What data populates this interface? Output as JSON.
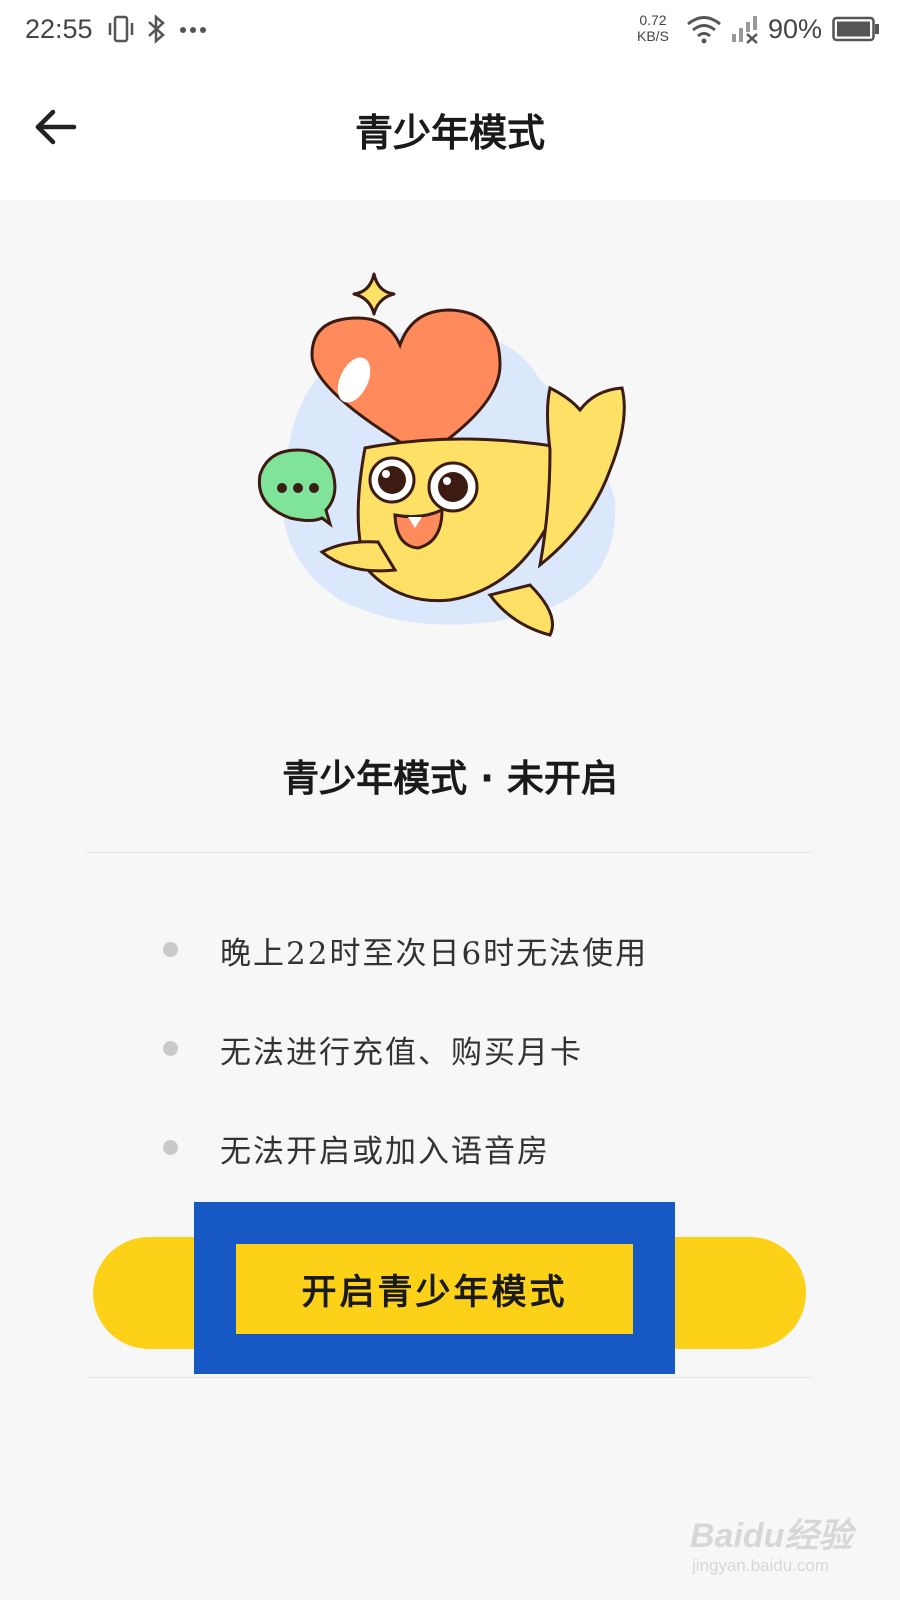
{
  "status_bar": {
    "time": "22:55",
    "net_speed_value": "0.72",
    "net_speed_unit": "KB/S",
    "battery_percent": "90%",
    "icons": [
      "vibrate-icon",
      "bluetooth-icon",
      "more-dots-icon",
      "wifi-icon",
      "signal-icon",
      "battery-icon"
    ]
  },
  "header": {
    "title": "青少年模式",
    "back_icon": "arrow-left-icon"
  },
  "illustration": {
    "name": "yellow-fish-mascot-with-heart",
    "colors": {
      "blob": "#dbe7fb",
      "heart": "#ff8a5b",
      "fish": "#fde066",
      "bubble": "#7fe39a",
      "outline": "#3b1b12"
    }
  },
  "status": {
    "title": "青少年模式 · 未开启"
  },
  "rules": [
    {
      "text": "晚上22时至次日6时无法使用"
    },
    {
      "text": "无法进行充值、购买月卡"
    },
    {
      "text": "无法开启或加入语音房"
    }
  ],
  "cta": {
    "label": "开启青少年模式",
    "colors": {
      "button": "#fcd117",
      "highlight_frame": "#1658c4"
    }
  },
  "watermark": {
    "brand": "Baidu经验",
    "url": "jingyan.baidu.com"
  }
}
